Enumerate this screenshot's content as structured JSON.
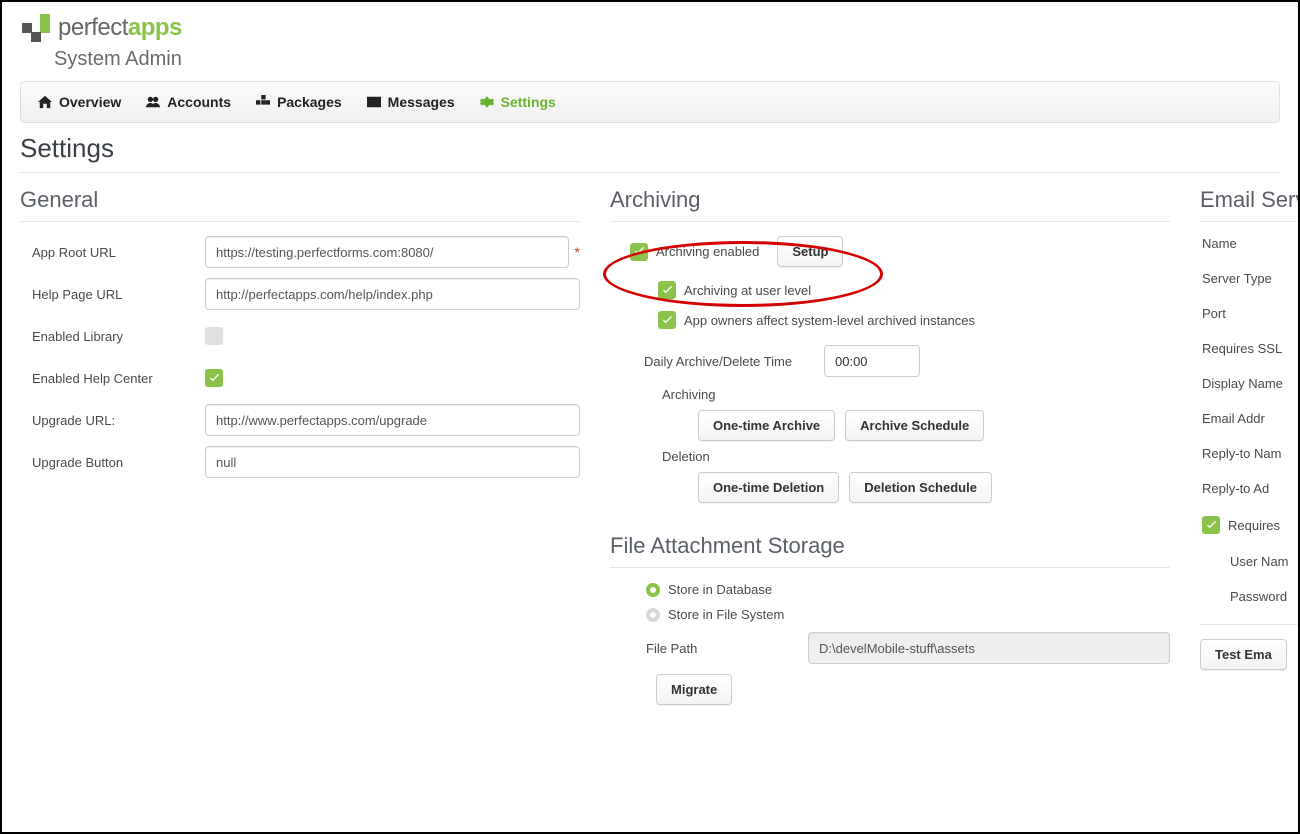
{
  "brand": {
    "perfect": "perfect",
    "apps": "apps",
    "subtitle": "System Admin"
  },
  "nav": {
    "overview": "Overview",
    "accounts": "Accounts",
    "packages": "Packages",
    "messages": "Messages",
    "settings": "Settings"
  },
  "page_title": "Settings",
  "general": {
    "title": "General",
    "app_root_url_label": "App Root URL",
    "app_root_url_value": "https://testing.perfectforms.com:8080/",
    "help_page_url_label": "Help Page URL",
    "help_page_url_value": "http://perfectapps.com/help/index.php",
    "enabled_library_label": "Enabled Library",
    "enabled_help_center_label": "Enabled Help Center",
    "upgrade_url_label": "Upgrade URL:",
    "upgrade_url_value": "http://www.perfectapps.com/upgrade",
    "upgrade_button_label": "Upgrade Button",
    "upgrade_button_value": "null"
  },
  "archiving": {
    "title": "Archiving",
    "enabled_label": "Archiving enabled",
    "setup_btn": "Setup",
    "user_level_label": "Archiving at user level",
    "owners_affect_label": "App owners affect system-level archived instances",
    "daily_time_label": "Daily Archive/Delete Time",
    "daily_time_value": "00:00",
    "archiving_heading": "Archiving",
    "one_time_archive_btn": "One-time Archive",
    "archive_schedule_btn": "Archive Schedule",
    "deletion_heading": "Deletion",
    "one_time_delete_btn": "One-time Deletion",
    "delete_schedule_btn": "Deletion Schedule"
  },
  "file_storage": {
    "title": "File Attachment Storage",
    "store_db_label": "Store in Database",
    "store_fs_label": "Store in File System",
    "file_path_label": "File Path",
    "file_path_value": "D:\\develMobile-stuff\\assets",
    "migrate_btn": "Migrate"
  },
  "email": {
    "title": "Email Serv",
    "name_label": "Name",
    "server_type_label": "Server Type",
    "port_label": "Port",
    "requires_ssl_label": "Requires SSL",
    "display_name_label": "Display Name",
    "email_addr_label": "Email Addr",
    "reply_to_name_label": "Reply-to Nam",
    "reply_to_addr_label": "Reply-to Ad",
    "requires_label": "Requires",
    "user_name_label": "User Nam",
    "password_label": "Password",
    "test_email_btn": "Test Ema"
  }
}
